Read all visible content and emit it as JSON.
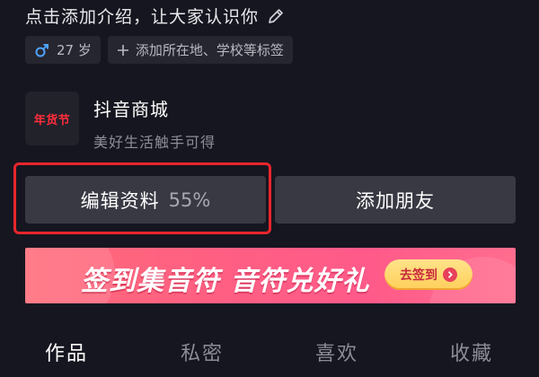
{
  "intro": {
    "text": "点击添加介绍，让大家认识你"
  },
  "tags": [
    {
      "icon": "male-icon",
      "label": "27 岁"
    },
    {
      "icon": "plus-icon",
      "label": "添加所在地、学校等标签"
    }
  ],
  "shop": {
    "logo_text": "年货节",
    "name": "抖音商城",
    "desc": "美好生活触手可得"
  },
  "buttons": {
    "edit_label": "编辑资料",
    "edit_progress": "55%",
    "add_friend_label": "添加朋友"
  },
  "banner": {
    "title": "签到集音符 音符兑好礼",
    "cta": "去签到"
  },
  "tabs": [
    "作品",
    "私密",
    "喜欢",
    "收藏"
  ],
  "colors": {
    "background": "#161620",
    "button": "#393944",
    "highlight": "#e8262b",
    "banner_pink": "#ff5f83"
  }
}
